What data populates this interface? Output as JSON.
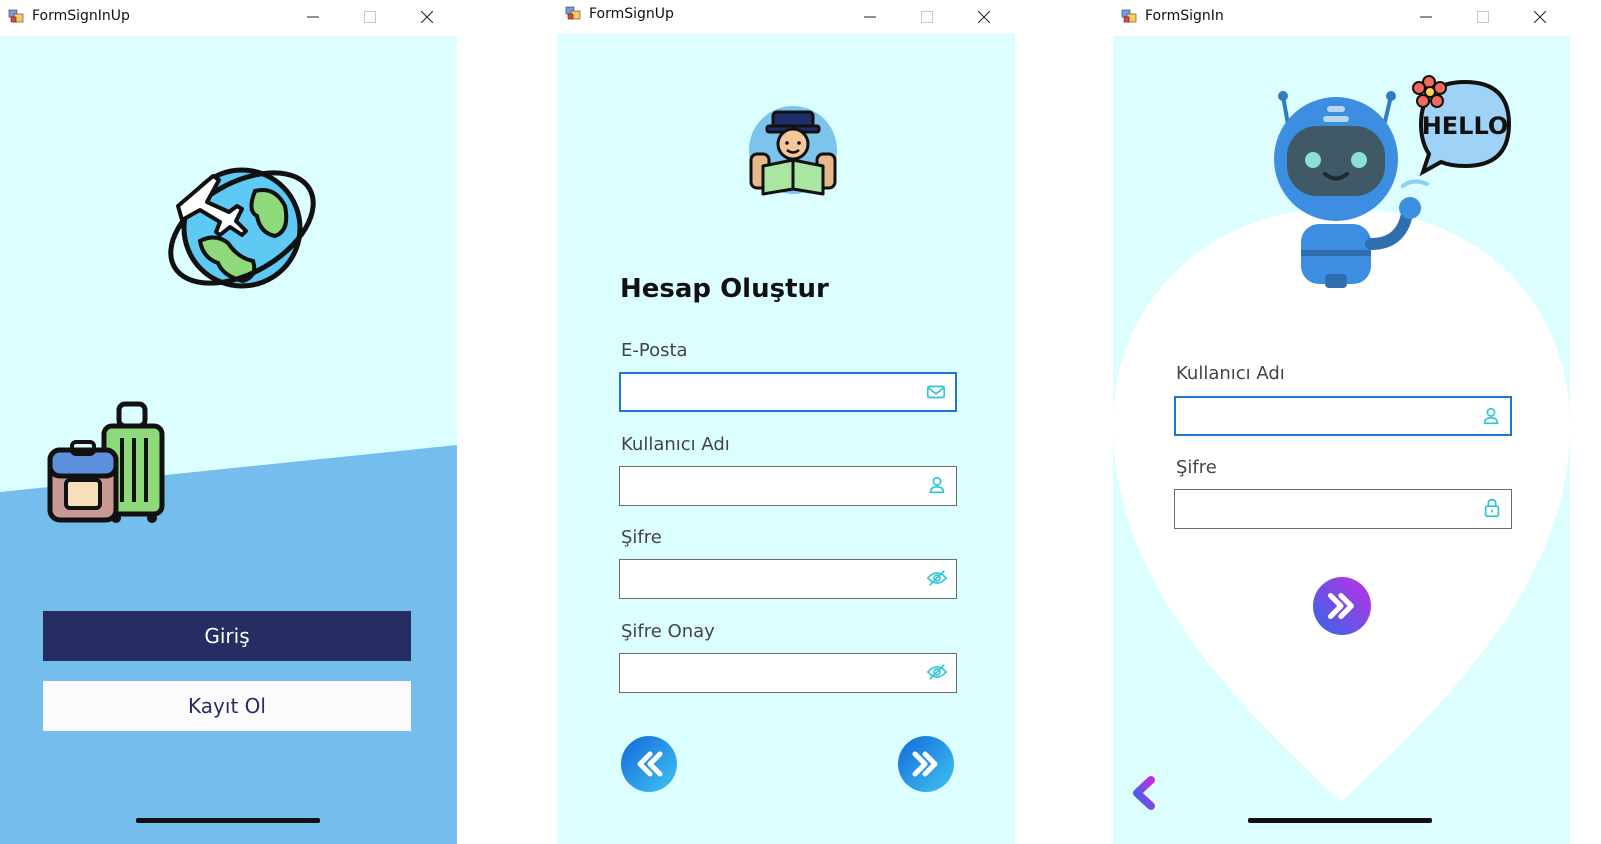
{
  "windows": [
    {
      "title": "FormSignInUp",
      "buttons": {
        "login": "Giriş",
        "register": "Kayıt Ol"
      }
    },
    {
      "title": "FormSignUp",
      "heading": "Hesap Oluştur",
      "fields": [
        {
          "label": "E-Posta",
          "value": "",
          "icon": "mail-icon"
        },
        {
          "label": "Kullanıcı Adı",
          "value": "",
          "icon": "user-icon"
        },
        {
          "label": "Şifre",
          "value": "",
          "icon": "eye-off-icon"
        },
        {
          "label": "Şifre Onay",
          "value": "",
          "icon": "eye-off-icon"
        }
      ]
    },
    {
      "title": "FormSignIn",
      "hello_text": "HELLO",
      "fields": [
        {
          "label": "Kullanıcı Adı",
          "value": "",
          "icon": "user-icon"
        },
        {
          "label": "Şifre",
          "value": "",
          "icon": "lock-icon"
        }
      ]
    }
  ],
  "colors": {
    "background": "#dcfefe",
    "blue_area": "#75bdec",
    "login_button": "#252d63",
    "focus_border": "#1e78d2",
    "icon_teal": "#2dc3d8",
    "gradient_blue": "#1a7de0",
    "gradient_purple": "#b32ee8"
  }
}
